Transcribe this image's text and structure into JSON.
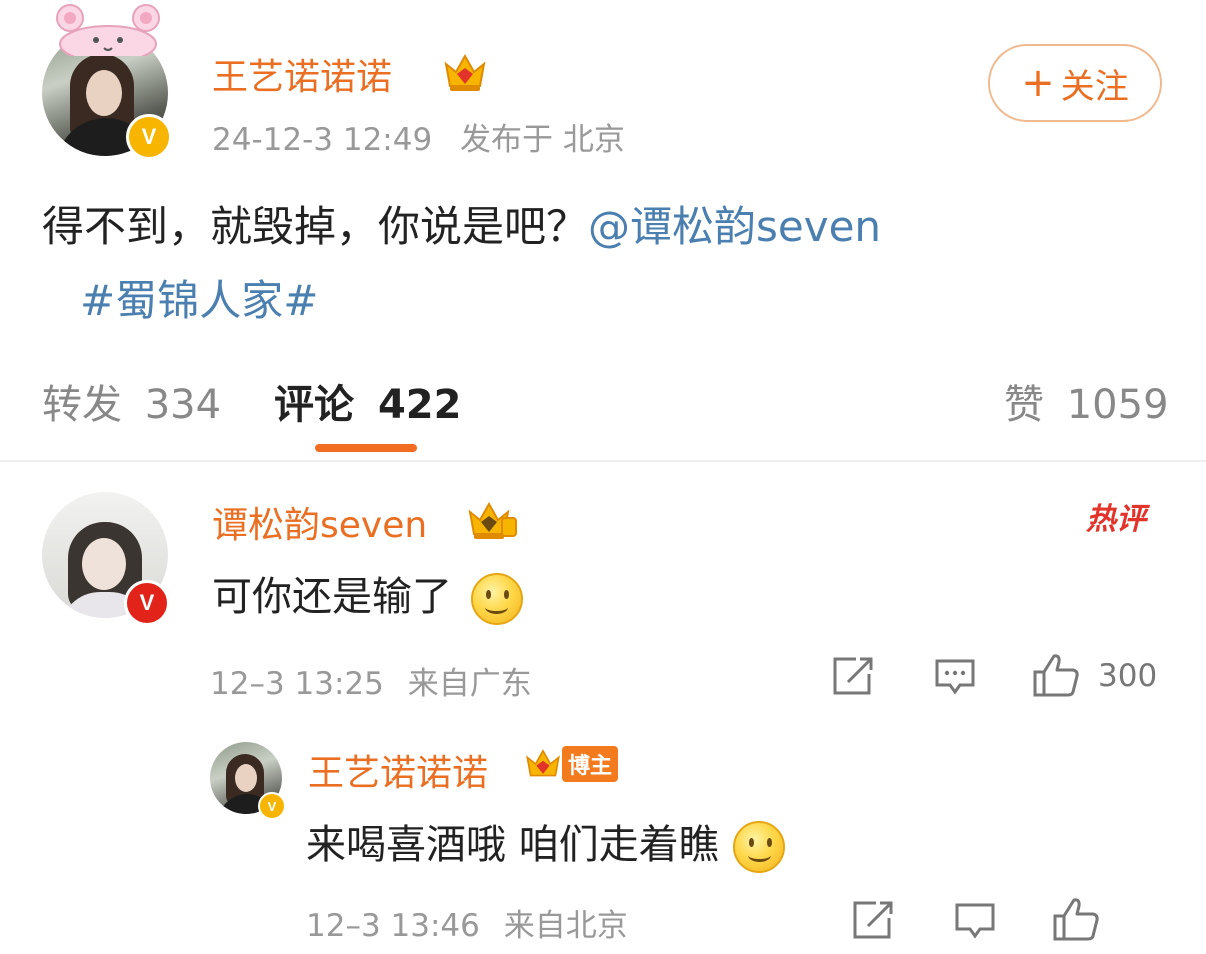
{
  "post": {
    "author": "王艺诺诺诺",
    "time": "24-12-3 12:49",
    "location": "发布于 北京",
    "follow_label": "关注",
    "text": "得不到，就毁掉，你说是吧？",
    "mention": "@谭松韵seven",
    "hashtag": "#蜀锦人家#",
    "verified_mark": "V"
  },
  "tabs": {
    "repost_label": "转发",
    "repost_count": "334",
    "comment_label": "评论",
    "comment_count": "422",
    "like_label": "赞",
    "like_count": "1059"
  },
  "comments": [
    {
      "author": "谭松韵seven",
      "text": "可你还是输了",
      "time": "12–3 13:25",
      "location": "来自广东",
      "hot_label": "热评",
      "like_count": "300",
      "verified_mark": "V"
    }
  ],
  "reply": {
    "author": "王艺诺诺诺",
    "badge": "博主",
    "text": "来喝喜酒哦 咱们走着瞧",
    "time": "12–3 13:46",
    "location": "来自北京",
    "verified_mark": "V"
  },
  "colors": {
    "name_orange": "#ea6f22",
    "link_blue": "#4a7fb0",
    "hot_red": "#e2342b",
    "tab_accent": "#f26c21"
  },
  "icons": [
    "crown-icon",
    "plus-icon",
    "repost-icon",
    "comment-icon",
    "like-icon",
    "smile-emoji"
  ]
}
